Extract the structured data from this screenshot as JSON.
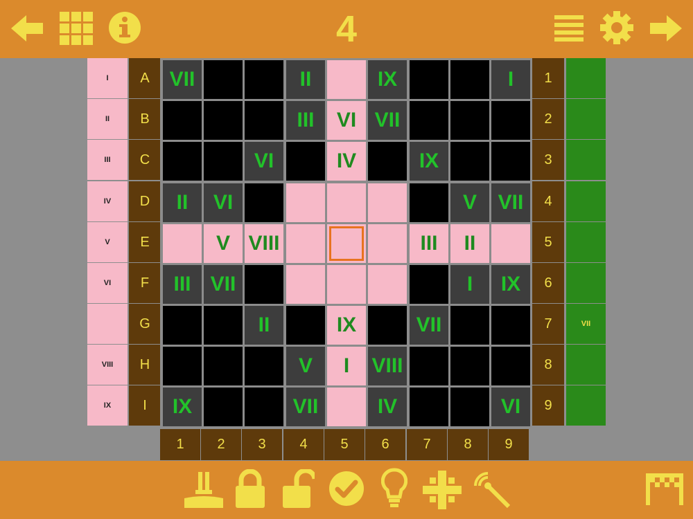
{
  "header": {
    "title": "4"
  },
  "icons": {
    "top": [
      "back-arrow-icon",
      "grid-icon",
      "info-icon",
      "menu-icon",
      "gear-icon",
      "forward-arrow-icon"
    ],
    "bottom": [
      "stamp-icon",
      "lock-icon",
      "unlock-icon",
      "check-icon",
      "lightbulb-icon",
      "cross-dots-icon",
      "magic-wand-icon",
      "finish-flag-icon"
    ]
  },
  "colors": {
    "bar": "#db8a2c",
    "accent_text": "#f2df4a",
    "brown": "#5e3a0b",
    "pink": "#f7b9c8",
    "green": "#2a8a1a",
    "digit_green": "#22c22a",
    "selection": "#e8731f"
  },
  "row_labels": [
    "I",
    "II",
    "III",
    "IV",
    "V",
    "VI",
    "",
    "VIII",
    "IX"
  ],
  "row_letters": [
    "A",
    "B",
    "C",
    "D",
    "E",
    "F",
    "G",
    "H",
    "I"
  ],
  "row_numbers": [
    "1",
    "2",
    "3",
    "4",
    "5",
    "6",
    "7",
    "8",
    "9"
  ],
  "right_labels": [
    "",
    "",
    "",
    "",
    "",
    "",
    "VII",
    "",
    ""
  ],
  "col_numbers": [
    "1",
    "2",
    "3",
    "4",
    "5",
    "6",
    "7",
    "8",
    "9"
  ],
  "grid": [
    [
      {
        "t": "d",
        "v": "VII"
      },
      {
        "t": "k",
        "v": ""
      },
      {
        "t": "k",
        "v": ""
      },
      {
        "t": "d",
        "v": "II"
      },
      {
        "t": "p",
        "v": ""
      },
      {
        "t": "d",
        "v": "IX"
      },
      {
        "t": "k",
        "v": ""
      },
      {
        "t": "k",
        "v": ""
      },
      {
        "t": "d",
        "v": "I"
      }
    ],
    [
      {
        "t": "k",
        "v": ""
      },
      {
        "t": "k",
        "v": ""
      },
      {
        "t": "k",
        "v": ""
      },
      {
        "t": "d",
        "v": "III"
      },
      {
        "t": "p",
        "v": "VI"
      },
      {
        "t": "d",
        "v": "VII"
      },
      {
        "t": "k",
        "v": ""
      },
      {
        "t": "k",
        "v": ""
      },
      {
        "t": "k",
        "v": ""
      }
    ],
    [
      {
        "t": "k",
        "v": ""
      },
      {
        "t": "k",
        "v": ""
      },
      {
        "t": "d",
        "v": "VI"
      },
      {
        "t": "k",
        "v": ""
      },
      {
        "t": "p",
        "v": "IV"
      },
      {
        "t": "k",
        "v": ""
      },
      {
        "t": "d",
        "v": "IX"
      },
      {
        "t": "k",
        "v": ""
      },
      {
        "t": "k",
        "v": ""
      }
    ],
    [
      {
        "t": "d",
        "v": "II"
      },
      {
        "t": "d",
        "v": "VI"
      },
      {
        "t": "k",
        "v": ""
      },
      {
        "t": "p",
        "v": ""
      },
      {
        "t": "p",
        "v": ""
      },
      {
        "t": "p",
        "v": ""
      },
      {
        "t": "k",
        "v": ""
      },
      {
        "t": "d",
        "v": "V"
      },
      {
        "t": "d",
        "v": "VII"
      }
    ],
    [
      {
        "t": "p",
        "v": ""
      },
      {
        "t": "p",
        "v": "V"
      },
      {
        "t": "p",
        "v": "VIII"
      },
      {
        "t": "p",
        "v": ""
      },
      {
        "t": "p",
        "v": "",
        "sel": true
      },
      {
        "t": "p",
        "v": ""
      },
      {
        "t": "p",
        "v": "III"
      },
      {
        "t": "p",
        "v": "II"
      },
      {
        "t": "p",
        "v": ""
      }
    ],
    [
      {
        "t": "d",
        "v": "III"
      },
      {
        "t": "d",
        "v": "VII"
      },
      {
        "t": "k",
        "v": ""
      },
      {
        "t": "p",
        "v": ""
      },
      {
        "t": "p",
        "v": ""
      },
      {
        "t": "p",
        "v": ""
      },
      {
        "t": "k",
        "v": ""
      },
      {
        "t": "d",
        "v": "I"
      },
      {
        "t": "d",
        "v": "IX"
      }
    ],
    [
      {
        "t": "k",
        "v": ""
      },
      {
        "t": "k",
        "v": ""
      },
      {
        "t": "d",
        "v": "II"
      },
      {
        "t": "k",
        "v": ""
      },
      {
        "t": "p",
        "v": "IX"
      },
      {
        "t": "k",
        "v": ""
      },
      {
        "t": "d",
        "v": "VII"
      },
      {
        "t": "k",
        "v": ""
      },
      {
        "t": "k",
        "v": ""
      }
    ],
    [
      {
        "t": "k",
        "v": ""
      },
      {
        "t": "k",
        "v": ""
      },
      {
        "t": "k",
        "v": ""
      },
      {
        "t": "d",
        "v": "V"
      },
      {
        "t": "p",
        "v": "I"
      },
      {
        "t": "d",
        "v": "VIII"
      },
      {
        "t": "k",
        "v": ""
      },
      {
        "t": "k",
        "v": ""
      },
      {
        "t": "k",
        "v": ""
      }
    ],
    [
      {
        "t": "d",
        "v": "IX"
      },
      {
        "t": "k",
        "v": ""
      },
      {
        "t": "k",
        "v": ""
      },
      {
        "t": "d",
        "v": "VII"
      },
      {
        "t": "p",
        "v": ""
      },
      {
        "t": "d",
        "v": "IV"
      },
      {
        "t": "k",
        "v": ""
      },
      {
        "t": "k",
        "v": ""
      },
      {
        "t": "d",
        "v": "VI"
      }
    ]
  ]
}
